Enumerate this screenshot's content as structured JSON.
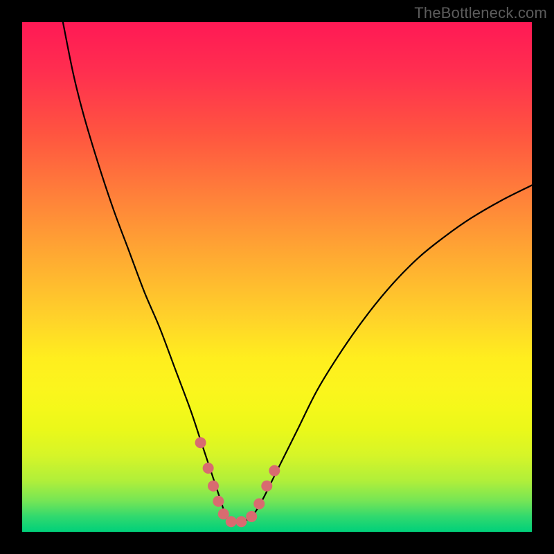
{
  "attribution": {
    "label": "TheBottleneck.com"
  },
  "colors": {
    "background": "#000000",
    "curve_stroke": "#000000",
    "marker_fill": "#d86b70",
    "attribution_text": "#5c5c5c"
  },
  "chart_data": {
    "type": "line",
    "title": "",
    "xlabel": "",
    "ylabel": "",
    "xlim": [
      0,
      100
    ],
    "ylim": [
      0,
      100
    ],
    "series": [
      {
        "name": "bottleneck-curve",
        "x": [
          8,
          10,
          12,
          15,
          18,
          21,
          24,
          27,
          30,
          33,
          35,
          37,
          39,
          40,
          41,
          43,
          45,
          47,
          50,
          54,
          58,
          63,
          68,
          73,
          78,
          83,
          88,
          94,
          100
        ],
        "y": [
          100,
          90,
          82,
          72,
          63,
          55,
          47,
          40,
          32,
          24,
          18,
          12,
          6,
          3,
          2,
          2,
          3,
          6,
          12,
          20,
          28,
          36,
          43,
          49,
          54,
          58,
          61.5,
          65,
          68
        ]
      }
    ],
    "markers": {
      "name": "bottom-highlight-dots",
      "points": [
        {
          "x": 35.0,
          "y": 17.5
        },
        {
          "x": 36.5,
          "y": 12.5
        },
        {
          "x": 37.5,
          "y": 9.0
        },
        {
          "x": 38.5,
          "y": 6.0
        },
        {
          "x": 39.5,
          "y": 3.5
        },
        {
          "x": 41.0,
          "y": 2.0
        },
        {
          "x": 43.0,
          "y": 2.0
        },
        {
          "x": 45.0,
          "y": 3.0
        },
        {
          "x": 46.5,
          "y": 5.5
        },
        {
          "x": 48.0,
          "y": 9.0
        },
        {
          "x": 49.5,
          "y": 12.0
        }
      ]
    }
  }
}
